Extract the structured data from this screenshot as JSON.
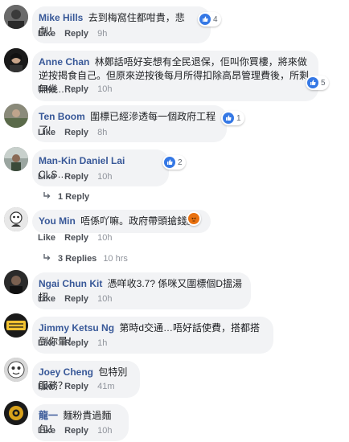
{
  "actions": {
    "like": "Like",
    "reply": "Reply"
  },
  "comments": [
    {
      "name": "Mike Hills",
      "text": "去到梅窩住都咁貴，悲劇！",
      "reactions": "4",
      "reaction_icon": "like-icon",
      "time": "9h"
    },
    {
      "name": "Anne Chan",
      "text": "林鄭話唔好妄想有全民退保，佢叫你買樓，將來做逆按揭食自己。但原來逆按後每月所得扣除高昂管理費後，所剩無幾……",
      "reactions": "5",
      "reaction_icon": "like-icon",
      "time": "10h"
    },
    {
      "name": "Ten Boom",
      "text": "圍標已經滲透每一個政府工程了!",
      "reactions": "1",
      "reaction_icon": "like-icon",
      "time": "8h"
    },
    {
      "name": "Man-Kin Daniel Lai",
      "text": "CLS……",
      "reactions": "2",
      "reaction_icon": "like-icon",
      "time": "10h",
      "replies": "1 Reply"
    },
    {
      "name": "You Min",
      "text": "唔係吖嘛。政府帶頭搶錢。",
      "reactions": "",
      "reaction_icon": "angry-icon",
      "time": "10h",
      "replies": "3 Replies",
      "replies_time": "10 hrs"
    },
    {
      "name": "Ngai Chun Kit",
      "text": "憑咩收3.7? 係咪又圍標個D搵湯招",
      "reactions": "",
      "reaction_icon": "",
      "time": "10h"
    },
    {
      "name": "Jimmy Ketsu Ng",
      "text": "第時d交通…唔好話使費，搭都搭到你暈！",
      "reactions": "",
      "reaction_icon": "",
      "time": "1h"
    },
    {
      "name": "Joey Cheng",
      "text": "包特別服務？",
      "reactions": "",
      "reaction_icon": "",
      "time": "41m"
    },
    {
      "name": "龍一",
      "text": "麵粉貴過麵包！",
      "reactions": "",
      "reaction_icon": "",
      "time": "10h"
    }
  ],
  "colors": {
    "name": "#385898",
    "bubble": "#f2f3f5",
    "like": "#3578e5",
    "angry": "#e9710f",
    "meta": "#606770"
  }
}
